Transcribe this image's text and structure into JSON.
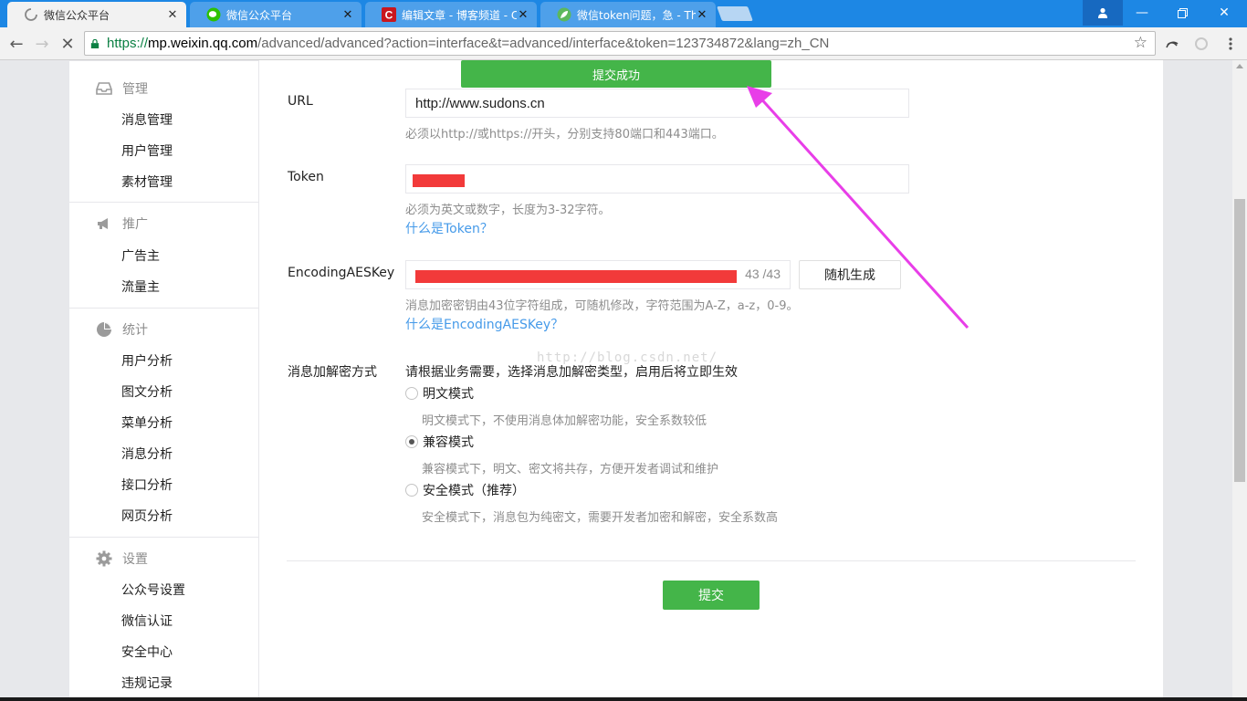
{
  "browser": {
    "tabs": [
      {
        "title": "微信公众平台",
        "active": true,
        "icon": "loading-spinner-icon"
      },
      {
        "title": "微信公众平台",
        "active": false,
        "icon": "wechat-icon"
      },
      {
        "title": "编辑文章 - 博客频道 - C",
        "active": false,
        "icon": "csdn-icon"
      },
      {
        "title": "微信token问题，急 - Th",
        "active": false,
        "icon": "leaf-icon"
      }
    ],
    "url": {
      "scheme": "https://",
      "host": "mp.weixin.qq.com",
      "path": "/advanced/advanced?action=interface&t=advanced/interface&token=123734872&lang=zh_CN"
    }
  },
  "sidebar": {
    "groups": [
      {
        "title": "管理",
        "icon": "inbox-icon",
        "items": [
          "消息管理",
          "用户管理",
          "素材管理"
        ]
      },
      {
        "title": "推广",
        "icon": "megaphone-icon",
        "items": [
          "广告主",
          "流量主"
        ]
      },
      {
        "title": "统计",
        "icon": "pie-chart-icon",
        "items": [
          "用户分析",
          "图文分析",
          "菜单分析",
          "消息分析",
          "接口分析",
          "网页分析"
        ]
      },
      {
        "title": "设置",
        "icon": "gear-icon",
        "items": [
          "公众号设置",
          "微信认证",
          "安全中心",
          "违规记录"
        ]
      }
    ]
  },
  "toast": {
    "text": "提交成功",
    "color": "#44b549"
  },
  "form": {
    "url": {
      "label": "URL",
      "value": "http://www.sudons.cn",
      "tip": "必须以http://或https://开头，分别支持80端口和443端口。"
    },
    "token": {
      "label": "Token",
      "value": "",
      "tip": "必须为英文或数字，长度为3-32字符。",
      "help_link": "什么是Token？"
    },
    "aes": {
      "label": "EncodingAESKey",
      "counter": "43 /43",
      "random_button": "随机生成",
      "tip": "消息加密密钥由43位字符组成，可随机修改，字符范围为A-Z，a-z，0-9。",
      "help_link": "什么是EncodingAESKey？"
    },
    "encrypt": {
      "label": "消息加解密方式",
      "intro": "请根据业务需要，选择消息加解密类型，启用后将立即生效",
      "options": [
        {
          "label": "明文模式",
          "desc": "明文模式下，不使用消息体加解密功能，安全系数较低",
          "selected": false
        },
        {
          "label": "兼容模式",
          "desc": "兼容模式下，明文、密文将共存，方便开发者调试和维护",
          "selected": true
        },
        {
          "label": "安全模式（推荐）",
          "desc": "安全模式下，消息包为纯密文，需要开发者加密和解密，安全系数高",
          "selected": false
        }
      ]
    },
    "submit": "提交"
  },
  "watermark": "http://blog.csdn.net/",
  "annotation_color": "#e83ee8"
}
